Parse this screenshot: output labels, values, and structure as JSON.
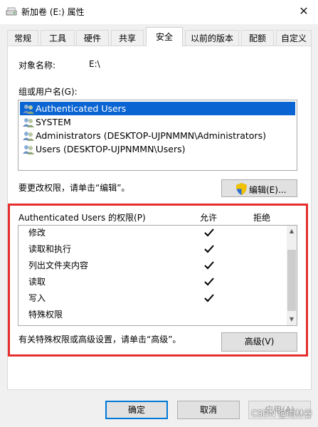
{
  "window": {
    "title": "新加卷 (E:) 属性",
    "close_glyph": "✕"
  },
  "tabs": [
    {
      "label": "常规"
    },
    {
      "label": "工具"
    },
    {
      "label": "硬件"
    },
    {
      "label": "共享"
    },
    {
      "label": "安全",
      "active": true
    },
    {
      "label": "以前的版本"
    },
    {
      "label": "配额"
    },
    {
      "label": "自定义"
    }
  ],
  "object": {
    "name_label": "对象名称:",
    "name_value": "E:\\"
  },
  "groups": {
    "label": "组或用户名(G):",
    "items": [
      {
        "name": "Authenticated Users",
        "selected": true
      },
      {
        "name": "SYSTEM"
      },
      {
        "name": "Administrators (DESKTOP-UJPNMMN\\Administrators)"
      },
      {
        "name": "Users (DESKTOP-UJPNMMN\\Users)"
      }
    ]
  },
  "edit": {
    "hint": "要更改权限，请单击“编辑”。",
    "button_label": "编辑(E)..."
  },
  "permissions": {
    "header": "Authenticated Users 的权限(P)",
    "allow_label": "允许",
    "deny_label": "拒绝",
    "rows": [
      {
        "name": "修改",
        "allow": true,
        "deny": false
      },
      {
        "name": "读取和执行",
        "allow": true,
        "deny": false
      },
      {
        "name": "列出文件夹内容",
        "allow": true,
        "deny": false
      },
      {
        "name": "读取",
        "allow": true,
        "deny": false
      },
      {
        "name": "写入",
        "allow": true,
        "deny": false
      },
      {
        "name": "特殊权限",
        "allow": false,
        "deny": false
      }
    ]
  },
  "advanced": {
    "hint": "有关特殊权限或高级设置，请单击“高级”。",
    "button_label": "高级(V)"
  },
  "footer": {
    "ok_label": "确定",
    "cancel_label": "取消",
    "apply_label": "应用(A)"
  },
  "watermark": "CSDN @雨林谷",
  "colors": {
    "selection": "#0a64d2",
    "highlight_box": "#e62e2e",
    "default_button_border": "#0078d7"
  }
}
